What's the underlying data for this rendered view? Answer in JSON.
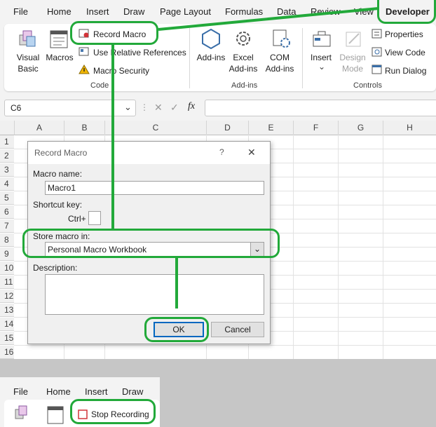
{
  "menu": {
    "tabs": [
      "File",
      "Home",
      "Insert",
      "Draw",
      "Page Layout",
      "Formulas",
      "Data",
      "Review",
      "View"
    ],
    "active_tab": "Developer"
  },
  "ribbon": {
    "code": {
      "visual_basic": "Visual Basic",
      "macros": "Macros",
      "record_macro": "Record Macro",
      "use_relative": "Use Relative References",
      "macro_security": "Macro Security",
      "group_label": "Code"
    },
    "addins": {
      "addins": "Add-ins",
      "excel_addins": "Excel Add-ins",
      "com_addins": "COM Add-ins",
      "group_label": "Add-ins"
    },
    "controls": {
      "insert": "Insert",
      "design_mode": "Design Mode",
      "properties": "Properties",
      "view_code": "View Code",
      "run_dialog": "Run Dialog",
      "group_label": "Controls"
    }
  },
  "formula_bar": {
    "name_box": "C6",
    "fx": "fx",
    "formula": ""
  },
  "grid": {
    "columns": [
      "A",
      "B",
      "C",
      "D",
      "E",
      "F",
      "G",
      "H"
    ],
    "rows": [
      "1",
      "2",
      "3",
      "4",
      "5",
      "6",
      "7",
      "8",
      "9",
      "10",
      "11",
      "12",
      "13",
      "14",
      "15",
      "16"
    ]
  },
  "dialog": {
    "title": "Record Macro",
    "help": "?",
    "close": "✕",
    "macro_name_label": "Macro name:",
    "macro_name_value": "Macro1",
    "shortcut_label": "Shortcut key:",
    "ctrl_label": "Ctrl+",
    "shortcut_value": "",
    "store_label": "Store macro in:",
    "store_value": "Personal Macro Workbook",
    "description_label": "Description:",
    "description_value": "",
    "ok": "OK",
    "cancel": "Cancel"
  },
  "bottom": {
    "tabs": [
      "File",
      "Home",
      "Insert",
      "Draw"
    ],
    "stop_recording": "Stop Recording"
  },
  "colors": {
    "highlight": "#22a93a",
    "ribbon_bg": "#f3f3f3",
    "dialog_bg": "#f0f0f0"
  }
}
